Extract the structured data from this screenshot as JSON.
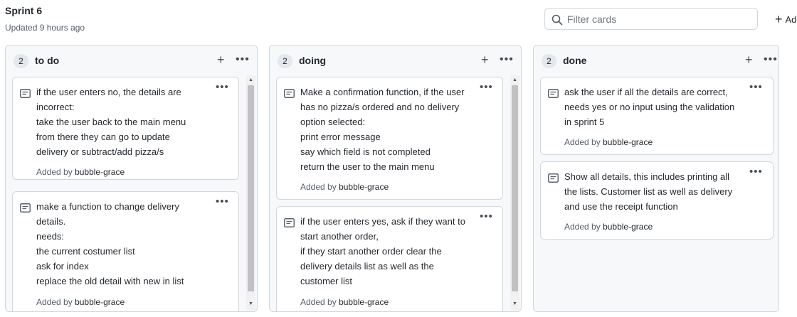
{
  "project": {
    "title": "Sprint 6",
    "updated": "Updated 9 hours ago"
  },
  "filter": {
    "placeholder": "Filter cards",
    "icon": "search-icon"
  },
  "add_column": {
    "plus": "+",
    "label": "Ad"
  },
  "columns": [
    {
      "count": "2",
      "name": "to do",
      "plus": "+",
      "menu": "•••",
      "cards": [
        {
          "text": "if the user enters no, the details are\nincorrect:\ntake the user back to the main menu\nfrom there they can go to update\ndelivery or subtract/add pizza/s",
          "added_by": "Added by",
          "author": "bubble-grace",
          "menu": "•••"
        },
        {
          "text": "make a function to change delivery\ndetails.\nneeds:\nthe current costumer list\nask for index\nreplace the old detail with new in list",
          "added_by": "Added by",
          "author": "bubble-grace",
          "menu": "•••"
        }
      ]
    },
    {
      "count": "2",
      "name": "doing",
      "plus": "+",
      "menu": "•••",
      "cards": [
        {
          "text": "Make a confirmation function, if the user\nhas no pizza/s ordered and no delivery\noption selected:\nprint error message\nsay which field is not completed\nreturn the user to the main menu",
          "added_by": "Added by",
          "author": "bubble-grace",
          "menu": "•••"
        },
        {
          "text": "if the user enters yes, ask if they want to\nstart another order,\nif they start another order clear the\ndelivery details list as well as the\ncustomer list",
          "added_by": "Added by",
          "author": "bubble-grace",
          "menu": "•••"
        }
      ]
    },
    {
      "count": "2",
      "name": "done",
      "plus": "+",
      "menu": "•••",
      "cards": [
        {
          "text": "ask the user if all the details are correct,\nneeds yes or no input using the validation\nin sprint 5",
          "added_by": "Added by",
          "author": "bubble-grace",
          "menu": "•••"
        },
        {
          "text": "Show all details, this includes printing all\nthe lists. Customer list as well as delivery\nand use the receipt function",
          "added_by": "Added by",
          "author": "bubble-grace",
          "menu": "•••"
        }
      ]
    }
  ],
  "scroll": {
    "up": "▲",
    "down": "▼"
  }
}
